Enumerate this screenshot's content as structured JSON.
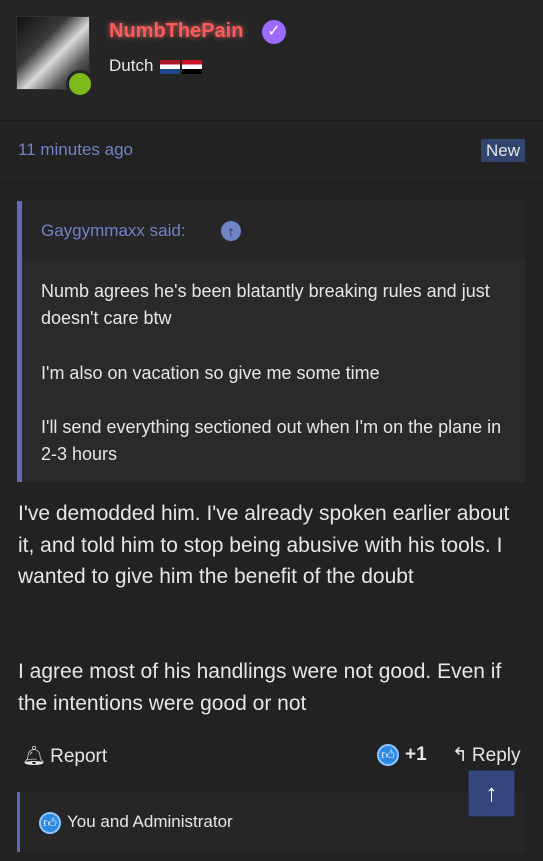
{
  "post": {
    "username": "NumbThePain",
    "user_title": "Dutch",
    "timestamp": "11 minutes ago",
    "badge": "New"
  },
  "quote": {
    "author": "Gaygymmaxx said:",
    "lines": [
      "Numb agrees he's been blatantly breaking rules and just doesn't care btw",
      "I'm also on vacation so give me some time",
      "I'll send everything sectioned out when I'm on the plane in 2-3 hours"
    ]
  },
  "body": [
    "I've demodded him. I've already spoken earlier about it, and told him to stop being abusive with his tools. I wanted to give him the benefit of the doubt",
    "I agree most of his handlings were not good. Even if the intentions were good or not"
  ],
  "actions": {
    "report": "Report",
    "like_count": "+1",
    "reply": "Reply"
  },
  "reactions": {
    "text": "You and Administrator"
  },
  "icons": {
    "verified": "check-badge-icon",
    "report": "bell-icon",
    "like": "thumbs-up-icon",
    "reply": "reply-arrow-icon",
    "scroll_top": "arrow-up-icon",
    "quote_jump": "arrow-up-circle-icon"
  },
  "colors": {
    "username": "#ff5a5a",
    "accent": "#6f83c9",
    "online": "#7dba1c",
    "like": "#2d8ae0"
  }
}
